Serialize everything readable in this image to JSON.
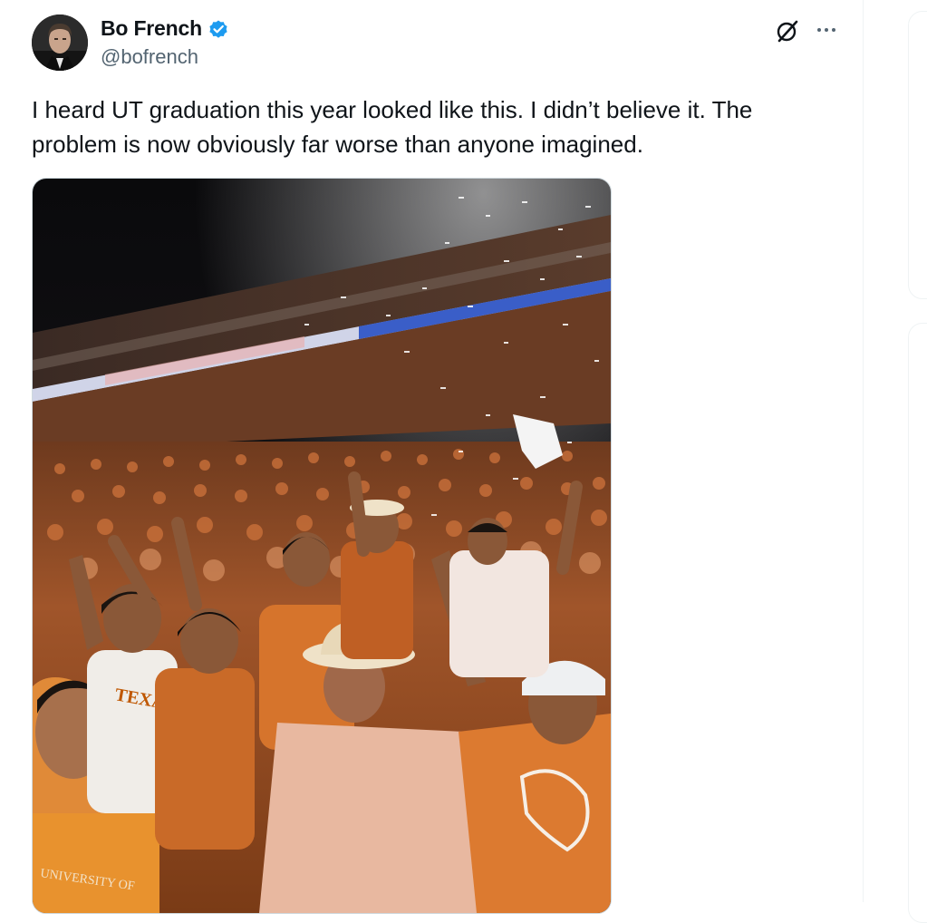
{
  "tweet": {
    "author": {
      "display_name": "Bo French",
      "handle": "@bofrench",
      "verified": true,
      "verified_color": "#1d9bf0"
    },
    "text": "I heard UT graduation this year looked like this. I didn’t believe it. The problem is now obviously far worse than anyone imagined.",
    "icons": {
      "grok": "grok-icon",
      "more": "more-icon"
    },
    "media": {
      "type": "photo",
      "jersey_text_1": "TEXAS",
      "jersey_text_2": "UNIVERSITY OF"
    }
  },
  "colors": {
    "text_primary": "#0f1419",
    "text_secondary": "#536471",
    "border": "#eff3f4",
    "burnt_orange": "#bf5700"
  }
}
